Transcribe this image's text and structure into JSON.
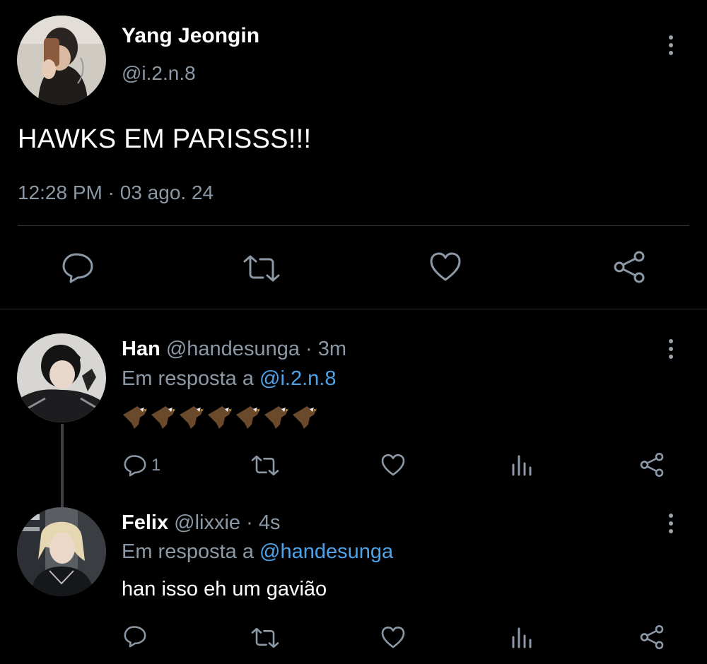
{
  "main_tweet": {
    "display_name": "Yang Jeongin",
    "handle": "@i.2.n.8",
    "text": "HAWKS EM PARISSS!!!",
    "time": "12:28 PM",
    "separator": "·",
    "date": "03 ago. 24",
    "actions": [
      "reply-icon",
      "retweet-icon",
      "like-icon",
      "share-icon"
    ]
  },
  "replies": [
    {
      "display_name": "Han",
      "handle": "@handesunga",
      "time_ago": "3m",
      "in_reply_label": "Em resposta a",
      "in_reply_to": "@i.2.n.8",
      "content_emoji": "🦅🦅🦅🦅🦅🦅🦅",
      "reply_count": "1"
    },
    {
      "display_name": "Felix",
      "handle": "@lixxie",
      "time_ago": "4s",
      "in_reply_label": "Em resposta a",
      "in_reply_to": "@handesunga",
      "text": "han isso eh um gavião"
    }
  ],
  "colors": {
    "background": "#000000",
    "text": "#ffffff",
    "muted": "#8b98a5",
    "link": "#4ea3e8",
    "divider": "#2f3336"
  }
}
